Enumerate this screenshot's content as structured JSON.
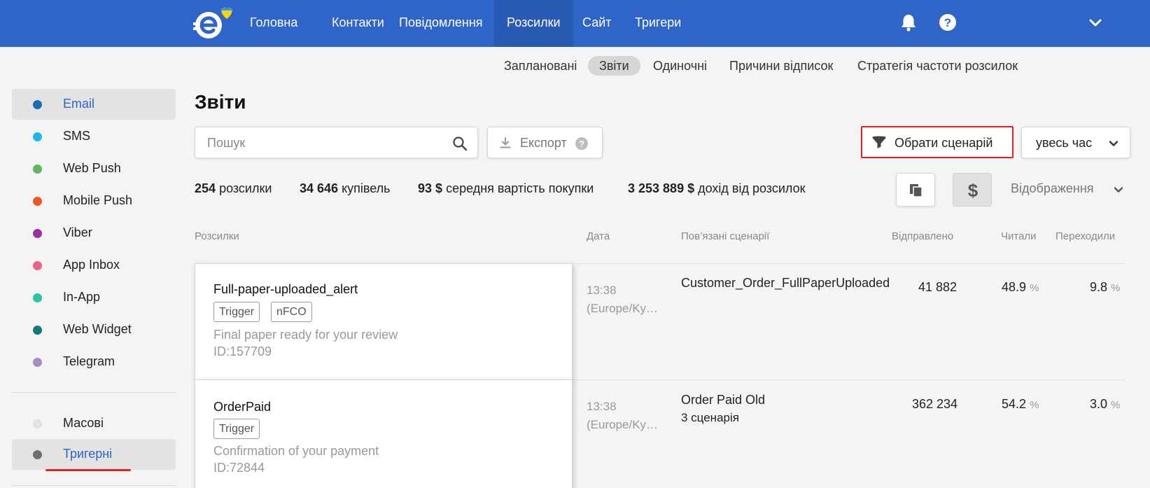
{
  "nav": {
    "items": [
      "Головна",
      "Контакти",
      "Повідомлення",
      "Розсилки",
      "Сайт",
      "Тригери"
    ],
    "active_index": 3
  },
  "colors": {
    "topbar": "#2f65c8",
    "accent": "#2f65c8",
    "highlight_border": "#e02020"
  },
  "subnav": {
    "items": [
      "Заплановані",
      "Звіти",
      "Одиночні",
      "Причини відписок",
      "Стратегія частоти розсилок"
    ],
    "active_index": 1
  },
  "sidebar": {
    "channels": [
      {
        "label": "Email",
        "color": "#1b6fb8"
      },
      {
        "label": "SMS",
        "color": "#1fb5e8"
      },
      {
        "label": "Web Push",
        "color": "#5cb85c"
      },
      {
        "label": "Mobile Push",
        "color": "#f0561d"
      },
      {
        "label": "Viber",
        "color": "#a02ca6"
      },
      {
        "label": "App Inbox",
        "color": "#f06088"
      },
      {
        "label": "In-App",
        "color": "#2ac4a4"
      },
      {
        "label": "Web Widget",
        "color": "#15787e"
      },
      {
        "label": "Telegram",
        "color": "#a98bc7"
      }
    ],
    "types": [
      {
        "label": "Масові",
        "color": "#e2e2e2"
      },
      {
        "label": "Тригерні",
        "color": "#707070"
      }
    ]
  },
  "page": {
    "title": "Звіти",
    "search_placeholder": "Пошук",
    "export_label": "Експорт",
    "scenario_button": "Обрати сценарій",
    "period": "увесь час",
    "view_label": "Відображення"
  },
  "stats": [
    {
      "value": "254",
      "label": "розсилки"
    },
    {
      "value": "34 646",
      "label": "купівель"
    },
    {
      "value": "93 $",
      "label": "середня вартість покупки"
    },
    {
      "value": "3 253 889 $",
      "label": "дохід від розсилок"
    }
  ],
  "table": {
    "columns": [
      "Розсилки",
      "Дата",
      "Пов’язані сценарії",
      "Відправлено",
      "Читали",
      "Переходили"
    ],
    "rows": [
      {
        "name": "Full-paper-uploaded_alert",
        "tags": [
          "Trigger",
          "nFCO"
        ],
        "subject": "Final paper ready for your review",
        "id": "ID:157709",
        "time": "13:38",
        "tz": "(Europe/Ky…",
        "scenario": "Customer_Order_FullPaperUploaded",
        "scenario_extra": "",
        "sent": "41 882",
        "read": "48.9",
        "clicked": "9.8",
        "pct": "%"
      },
      {
        "name": "OrderPaid",
        "tags": [
          "Trigger"
        ],
        "subject": "Confirmation of your payment",
        "id": "ID:72844",
        "time": "13:38",
        "tz": "(Europe/Ky…",
        "scenario": "Order Paid Old",
        "scenario_extra": "3 сценарія",
        "sent": "362 234",
        "read": "54.2",
        "clicked": "3.0",
        "pct": "%"
      }
    ]
  }
}
